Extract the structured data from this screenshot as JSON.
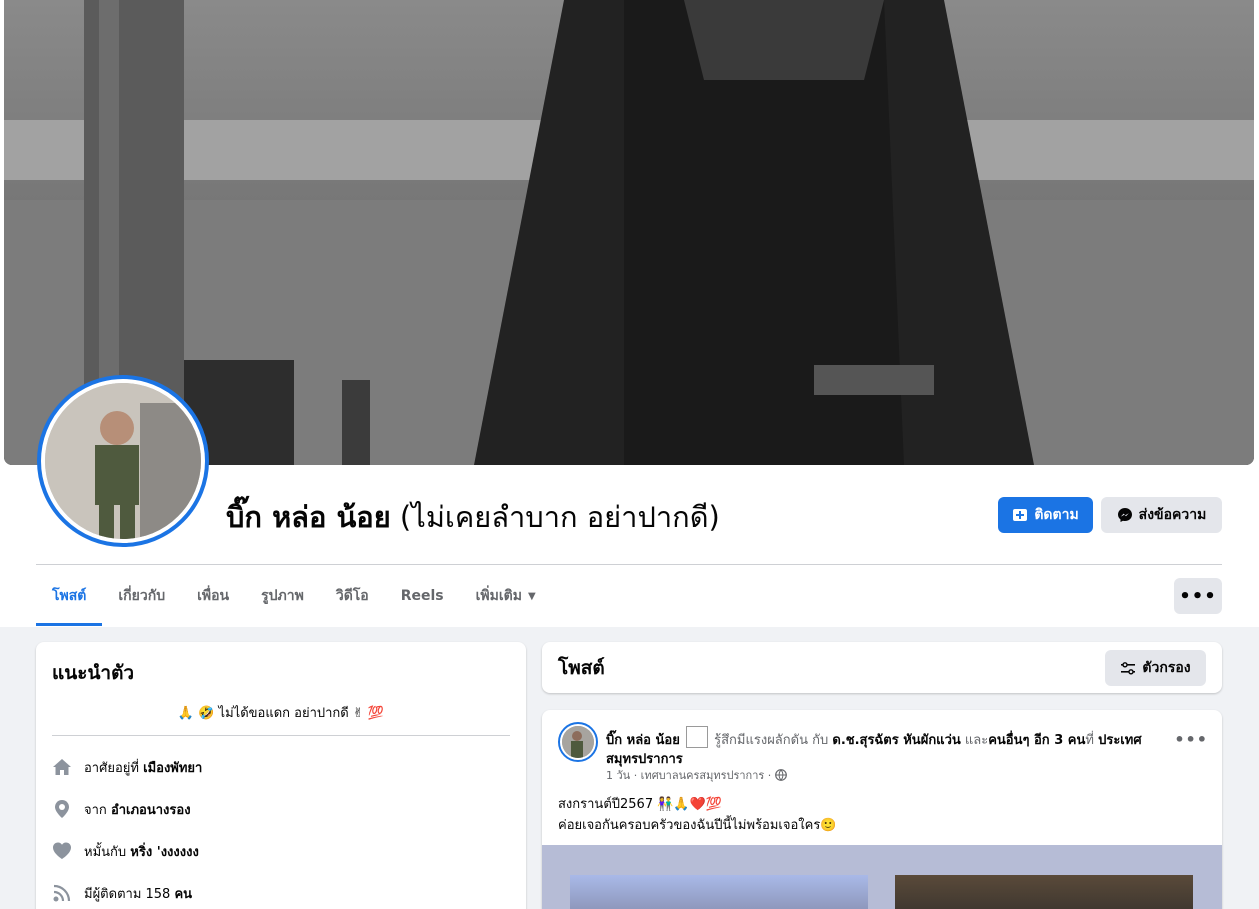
{
  "profile": {
    "name": "บิ๊ก หล่อ น้อย",
    "alt_name": "(ไม่เคยลำบาก อย่าปากดี)",
    "follow_label": "ติดตาม",
    "message_label": "ส่งข้อความ",
    "more_label": "•••"
  },
  "tabs": [
    {
      "label": "โพสต์",
      "active": true
    },
    {
      "label": "เกี่ยวกับ"
    },
    {
      "label": "เพื่อน"
    },
    {
      "label": "รูปภาพ"
    },
    {
      "label": "วิดีโอ"
    },
    {
      "label": "Reels"
    },
    {
      "label": "เพิ่มเติม"
    }
  ],
  "intro": {
    "title": "แนะนำตัว",
    "bio": "🙏 🤣 ไม่ได้ขอแดก อย่าปากดี ✌ 💯",
    "rows": [
      {
        "icon": "home-icon",
        "prefix": "อาศัยอยู่ที่",
        "value": "เมืองพัทยา"
      },
      {
        "icon": "location-pin-icon",
        "prefix": "จาก",
        "value": "อำเภอนางรอง"
      },
      {
        "icon": "heart-icon",
        "prefix": "หมั้นกับ",
        "value": "หริ่ง 'งงงงงง"
      },
      {
        "icon": "followers-icon",
        "prefix": "มีผู้ติดตาม 158",
        "value": "คน"
      }
    ]
  },
  "posts_header": {
    "title": "โพสต์",
    "filter_label": "ตัวกรอง"
  },
  "post": {
    "author": "บิ๊ก หล่อ น้อย",
    "feeling": "รู้สึกมีแรงผลักดัน กับ",
    "tagged": "ด.ช.สุรฉัตร หันผักแว่น",
    "and": "และ",
    "others": "คนอื่นๆ อีก 3 คน",
    "at": "ที่",
    "place": "ประเทศสมุทรปราการ",
    "meta": "1 วัน · เทศบาลนครสมุทรปราการ ·",
    "line1": "สงกรานต์ปี2567 👫🙏❤️💯",
    "line2": "ค่อยเจอกันครอบครัวของฉันปีนี้ไม่พร้อมเจอใคร🙂",
    "more_label": "•••"
  },
  "colors": {
    "accent": "#1b74e4",
    "secondary_button": "#e4e6eb",
    "page_bg": "#f0f2f5"
  }
}
